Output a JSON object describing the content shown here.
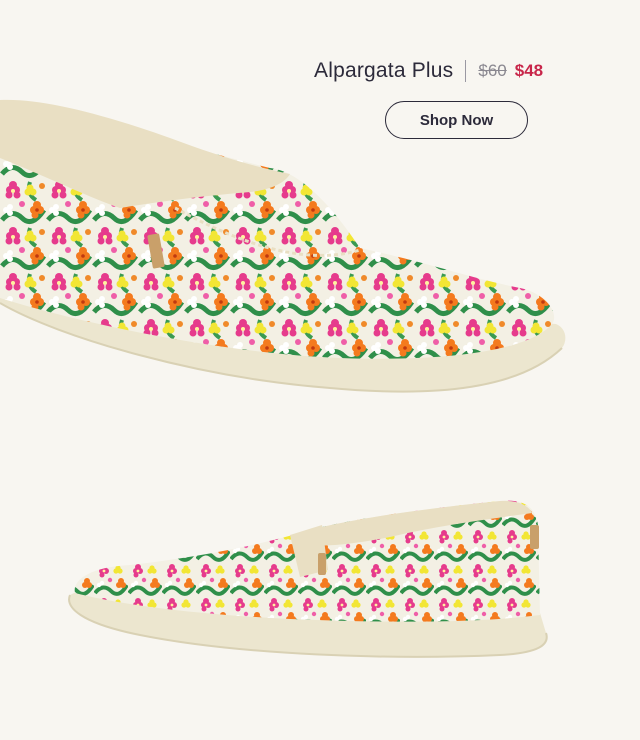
{
  "product": {
    "name": "Alpargata Plus",
    "original_price": "$60",
    "sale_price": "$48"
  },
  "cta": {
    "label": "Shop Now"
  },
  "colors": {
    "background": "#f8f6f1",
    "sale_price": "#c8264a",
    "text": "#2c2a3a"
  },
  "images": [
    {
      "name": "floral-alpargata-side-view",
      "pattern": "pink, orange and yellow floral print"
    },
    {
      "name": "floral-alpargata-angled-view",
      "pattern": "pink, orange and yellow floral print"
    }
  ]
}
